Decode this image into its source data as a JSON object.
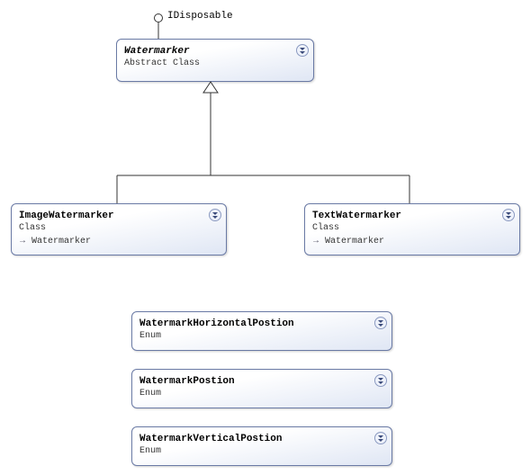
{
  "interface": {
    "name": "IDisposable"
  },
  "classes": {
    "watermarker": {
      "name": "Watermarker",
      "stereotype": "Abstract Class"
    },
    "image_watermarker": {
      "name": "ImageWatermarker",
      "stereotype": "Class",
      "base": "Watermarker"
    },
    "text_watermarker": {
      "name": "TextWatermarker",
      "stereotype": "Class",
      "base": "Watermarker"
    }
  },
  "enums": {
    "h_pos": {
      "name": "WatermarkHorizontalPostion",
      "stereotype": "Enum"
    },
    "pos": {
      "name": "WatermarkPostion",
      "stereotype": "Enum"
    },
    "v_pos": {
      "name": "WatermarkVerticalPostion",
      "stereotype": "Enum"
    }
  },
  "glyphs": {
    "inherit_arrow": "→"
  }
}
